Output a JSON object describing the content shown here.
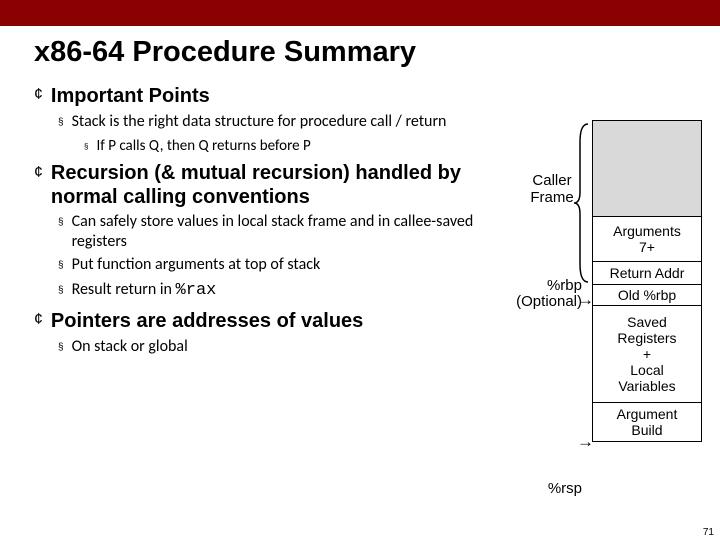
{
  "title": "x86-64 Procedure Summary",
  "sections": [
    {
      "heading": "Important Points",
      "items": [
        {
          "text": "Stack is the right data structure for procedure call / return",
          "sub": [
            "If P calls Q, then Q returns before P"
          ]
        }
      ]
    },
    {
      "heading": "Recursion (& mutual recursion) handled by normal calling conventions",
      "items": [
        {
          "text": "Can safely store values in local stack frame and in callee-saved registers"
        },
        {
          "text": "Put function arguments at top of stack"
        },
        {
          "text_pre": "Result return in ",
          "text_code": "%rax"
        }
      ]
    },
    {
      "heading": "Pointers are addresses of values",
      "items": [
        {
          "text": "On stack or global"
        }
      ]
    }
  ],
  "diagram": {
    "caller_label": "Caller\nFrame",
    "args": "Arguments\n7+",
    "ret": "Return Addr",
    "oldrbp": "Old %rbp",
    "saved": "Saved\nRegisters\n+\nLocal\nVariables",
    "argbuild": "Argument\nBuild",
    "rbp": "%rbp",
    "rbp_note": "(Optional)",
    "rsp": "%rsp"
  },
  "pagenum": "71"
}
